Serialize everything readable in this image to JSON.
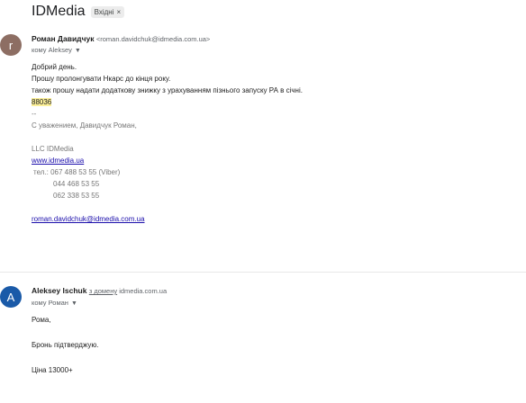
{
  "subject": {
    "title": "IDMedia",
    "label": "Вхідні",
    "label_close": "×"
  },
  "message1": {
    "avatar_letter": "r",
    "sender_name": "Роман Давидчук",
    "sender_email": "<roman.davidchuk@idmedia.com.ua>",
    "to": "кому Aleksey",
    "lines": {
      "l1": "Добрий день.",
      "l2": "Прошу пролонгувати Нкарс до кінця року.",
      "l3": "також прошу надати додаткову знижку з урахуванням пізнього запуску РА в січні.",
      "l4": "88036",
      "l5": "--",
      "l6": "С уважением, Давидчук Роман,",
      "l7": "LLC IDMedia",
      "l8": "www.idmedia.ua",
      "l9": "тел.: 067 488 53 55 (Viber)",
      "l10": "044 468 53 55",
      "l11": "062 338 53 55",
      "l12": "roman.davidchuk@idmedia.com.ua"
    }
  },
  "message2": {
    "avatar_letter": "A",
    "sender_name": "Aleksey Ischuk",
    "via_text": "з домену",
    "via_domain": "idmedia.com.ua",
    "to": "кому Роман",
    "lines": {
      "l1": "Рома,",
      "l2": "Бронь підтверджую.",
      "l3": "Ціна 13000+"
    }
  },
  "colors": {
    "avatar_r": "#8d6e63",
    "avatar_a": "#1a5aa8",
    "highlight": "#fcf09a",
    "link": "#1a0dab"
  }
}
